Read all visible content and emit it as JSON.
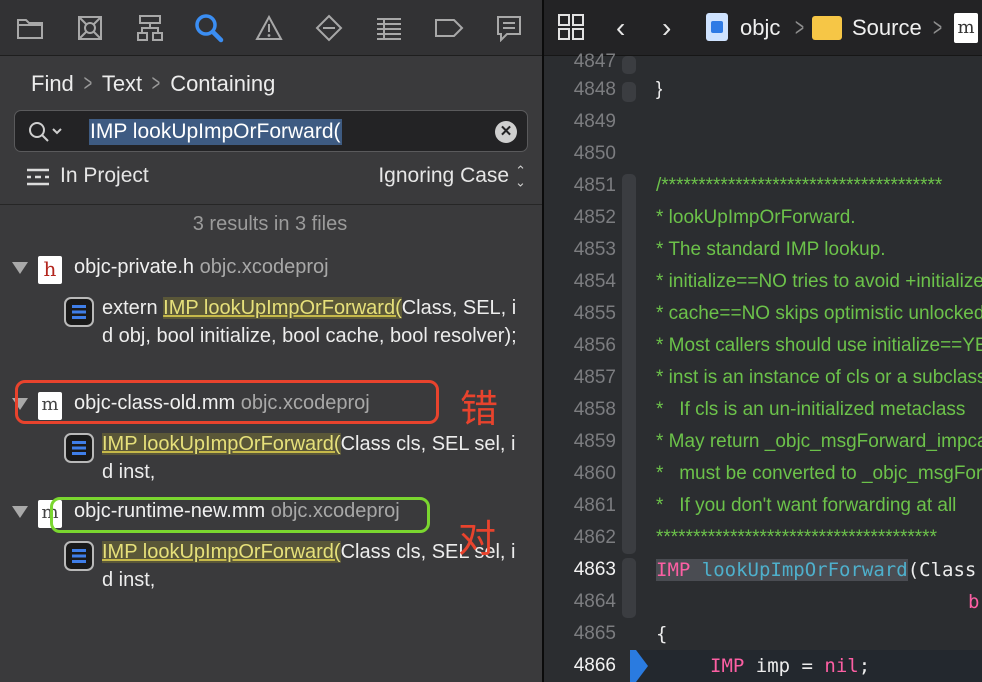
{
  "navigator": {
    "toolbar_icons": [
      "folder-icon",
      "source-control-icon",
      "hierarchy-icon",
      "search-icon",
      "warning-icon",
      "test-icon",
      "debug-icon",
      "breakpoint-icon",
      "report-icon"
    ],
    "breadcrumb": {
      "part1": "Find",
      "part2": "Text",
      "part3": "Containing"
    },
    "search": {
      "query": "IMP lookUpImpOrForward("
    },
    "scope": {
      "label": "In Project",
      "case": "Ignoring Case"
    },
    "summary": "3 results in 3 files",
    "files": [
      {
        "icon_letter": "h",
        "name": "objc-private.h",
        "project": "objc.xcodeproj",
        "match_pre": "extern ",
        "match_hit": "IMP lookUpImpOrForward(",
        "match_post": "Class, SEL, id obj, bool initialize, bool cache, bool resolver);"
      },
      {
        "icon_letter": "m",
        "name": "objc-class-old.mm",
        "project": "objc.xcodeproj",
        "match_pre": "",
        "match_hit": "IMP lookUpImpOrForward(",
        "match_post": "Class cls, SEL sel, id inst,"
      },
      {
        "icon_letter": "m",
        "name": "objc-runtime-new.mm",
        "project": "objc.xcodeproj",
        "match_pre": "",
        "match_hit": "IMP lookUpImpOrForward(",
        "match_post": "Class cls, SEL sel, id inst,"
      }
    ],
    "annotations": {
      "wrong": "错",
      "right": "对",
      "wrong_color": "#e8432d",
      "right_color": "#7ad62f"
    }
  },
  "editor": {
    "jump_bar": {
      "project": "objc",
      "folder": "Source",
      "file_icon_letter": "m"
    },
    "line_numbers": [
      "4847",
      "4848",
      "4849",
      "4850",
      "4851",
      "4852",
      "4853",
      "4854",
      "4855",
      "4856",
      "4857",
      "4858",
      "4859",
      "4860",
      "4861",
      "4862",
      "4863",
      "4864",
      "4865",
      "4866"
    ],
    "current_line": "4866",
    "lines": {
      "l4848": "}",
      "l4851": "/**************************************",
      "l4852": "* lookUpImpOrForward.",
      "l4853": "* The standard IMP lookup.",
      "l4854": "* initialize==NO tries to avoid +initialize",
      "l4855": "* cache==NO skips optimistic unlocked lookup",
      "l4856": "* Most callers should use initialize==YES",
      "l4857": "* inst is an instance of cls or a subclass",
      "l4858": "*   If cls is an un-initialized metaclass",
      "l4859": "* May return _objc_msgForward_impcache",
      "l4860": "*   must be converted to _objc_msgForward",
      "l4861": "*   If you don't want forwarding at all",
      "l4862": "**************************************",
      "l4863_kw": "IMP",
      "l4863_fn": "lookUpImpOrForward",
      "l4863_rest": "(Class cls,",
      "l4864": "b",
      "l4865": "{",
      "l4866_kw": "IMP",
      "l4866_rest": " imp = ",
      "l4866_nil": "nil",
      "l4866_end": ";"
    }
  },
  "colors": {
    "highlight": "#e6e07a",
    "accent_blue": "#2a7be0",
    "comment_green": "#6cc24a",
    "keyword_pink": "#fc5fa3"
  }
}
